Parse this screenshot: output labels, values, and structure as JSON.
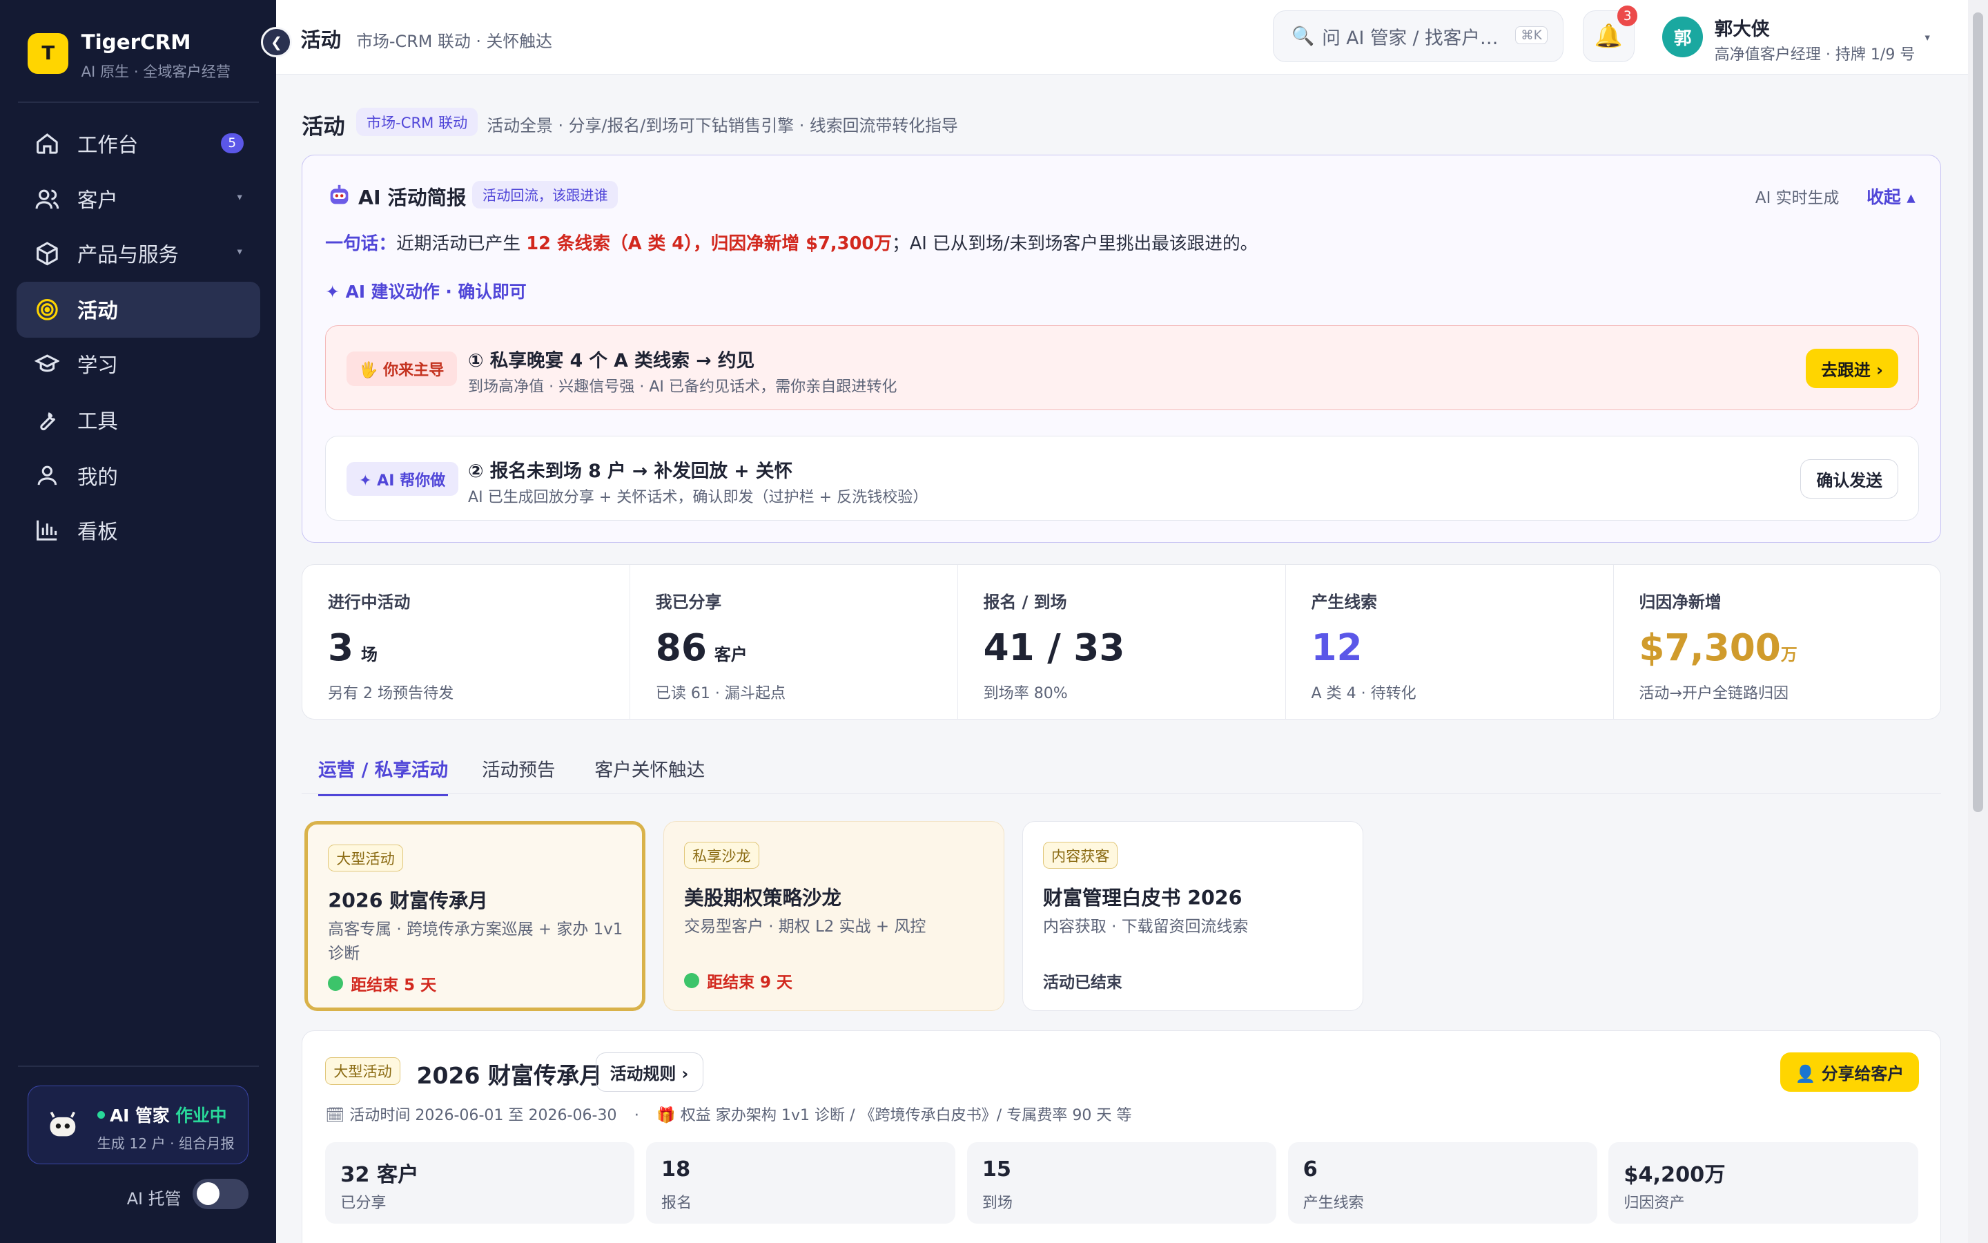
{
  "brand": {
    "name": "TigerCRM",
    "tagline": "AI 原生 · 全域客户经营",
    "logo_letter": "T"
  },
  "sidebar": {
    "items": [
      {
        "label": "工作台",
        "icon": "home-icon",
        "badge": "5"
      },
      {
        "label": "客户",
        "icon": "users-icon",
        "expand": "▾"
      },
      {
        "label": "产品与服务",
        "icon": "box-icon",
        "expand": "▾"
      },
      {
        "label": "活动",
        "icon": "target-icon",
        "active": true
      },
      {
        "label": "学习",
        "icon": "graduation-cap-icon"
      },
      {
        "label": "工具",
        "icon": "wrench-icon"
      },
      {
        "label": "我的",
        "icon": "user-icon"
      },
      {
        "label": "看板",
        "icon": "bar-chart-icon"
      }
    ],
    "ai_status": {
      "title": "AI 管家",
      "state": "作业中",
      "detail": "生成 12 户 · 组合月报"
    },
    "ai_hosting": {
      "label": "AI 托管",
      "on": false
    }
  },
  "header": {
    "title": "活动",
    "subtitle": "市场-CRM 联动 · 关怀触达",
    "search_placeholder": "问 AI 管家 / 找客户…",
    "search_shortcut": "⌘K",
    "notifications": "3",
    "user": {
      "avatar": "郭",
      "name": "郭大侠",
      "role": "高净值客户经理 · 持牌 1/9 号"
    }
  },
  "page": {
    "title": "活动",
    "tag": "市场-CRM 联动",
    "subtitle": "活动全景 · 分享/报名/到场可下钻销售引擎 · 线索回流带转化指导"
  },
  "ai_brief": {
    "title": "AI 活动简报",
    "tag": "活动回流，该跟进谁",
    "realtime": "AI 实时生成",
    "collapse": "收起 ▴",
    "oneliner_label": "一句话：",
    "oneliner_a": "近期活动已产生 ",
    "oneliner_hl1": "12 条线索（A 类 4），",
    "oneliner_hl2": "归因净新增 $7,300万",
    "oneliner_b": "；AI 已从到场/未到场客户里挑出最该跟进的。",
    "suggest": "✦ AI 建议动作 · 确认即可",
    "actions": [
      {
        "pill": "🖐 你来主导",
        "title": "① 私享晚宴 4 个 A 类线索 → 约见",
        "sub": "到场高净值 · 兴趣信号强 · AI 已备约见话术，需你亲自跟进转化",
        "button": "去跟进 ›"
      },
      {
        "pill": "✦ AI 帮你做",
        "title": "② 报名未到场 8 户 → 补发回放 + 关怀",
        "sub": "AI 已生成回放分享 + 关怀话术，确认即发（过护栏 + 反洗钱校验）",
        "button": "确认发送"
      }
    ]
  },
  "stats": [
    {
      "label": "进行中活动",
      "value": "3",
      "unit": "场",
      "sub": "另有 2 场预告待发"
    },
    {
      "label": "我已分享",
      "value": "86",
      "unit": "客户",
      "sub": "已读 61 · 漏斗起点"
    },
    {
      "label": "报名 / 到场",
      "value": "41 / 33",
      "unit": "",
      "sub": "到场率 80%"
    },
    {
      "label": "产生线索",
      "value": "12",
      "unit": "",
      "sub": "A 类 4 · 待转化",
      "color": "#5b57e8"
    },
    {
      "label": "归因净新增",
      "value": "$7,300",
      "unit": "万",
      "sub": "活动→开户全链路归因",
      "color": "#d09b2c"
    }
  ],
  "tabs": [
    "运营 / 私享活动",
    "活动预告",
    "客户关怀触达"
  ],
  "cards": [
    {
      "badge": "大型活动",
      "title": "2026 财富传承月",
      "desc": "高客专属 · 跨境传承方案巡展 + 家办 1v1 诊断",
      "footer": "距结束 5 天"
    },
    {
      "badge": "私享沙龙",
      "title": "美股期权策略沙龙",
      "desc": "交易型客户 · 期权 L2 实战 + 风控",
      "footer": "距结束 9 天"
    },
    {
      "badge": "内容获客",
      "title": "财富管理白皮书 2026",
      "desc": "内容获取 · 下载留资回流线索",
      "footer": "活动已结束"
    }
  ],
  "detail": {
    "badge": "大型活动",
    "title": "2026 财富传承月",
    "rules": "活动规则 ›",
    "share": "👤 分享给客户",
    "time": "活动时间 2026-06-01 至 2026-06-30",
    "benefit": "权益 家办架构 1v1 诊断 / 《跨境传承白皮书》/ 专属费率 90 天 等",
    "metrics": [
      {
        "value": "32 客户",
        "label": "已分享"
      },
      {
        "value": "18",
        "label": "报名"
      },
      {
        "value": "15",
        "label": "到场"
      },
      {
        "value": "6",
        "label": "产生线索"
      },
      {
        "value": "$4,200万",
        "label": "归因资产"
      }
    ]
  }
}
